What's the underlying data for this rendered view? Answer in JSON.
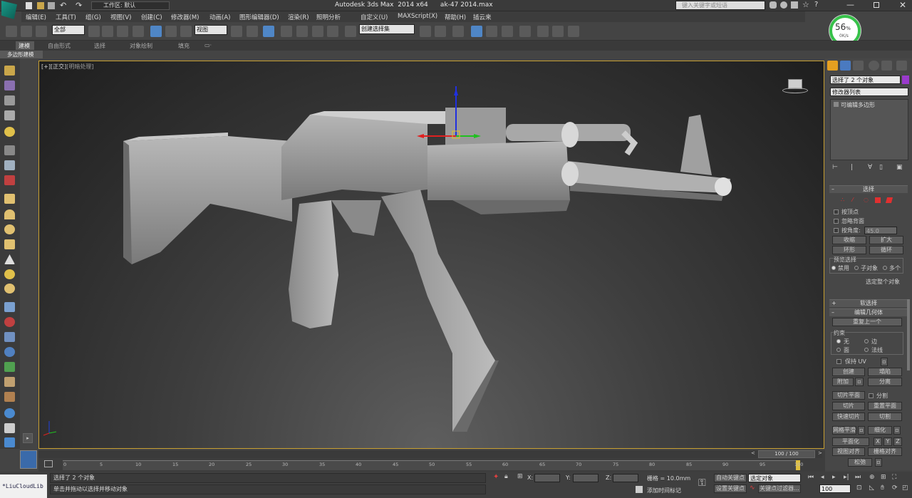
{
  "app": {
    "workspace_label": "工作区: 默认",
    "title": "Autodesk 3ds Max  2014 x64      ak-47 2014.max",
    "search_placeholder": "键入关键字或短语"
  },
  "menus": [
    "编辑(E)",
    "工具(T)",
    "组(G)",
    "视图(V)",
    "创建(C)",
    "修改器(M)",
    "动画(A)",
    "图形编辑器(D)",
    "渲染(R)",
    "照明分析",
    "自定义(U)",
    "MAXScript(X)",
    "帮助(H)",
    "插云来"
  ],
  "toolbar": {
    "selection_filter": "全部",
    "ref_coord": "视图",
    "named_sel": "创建选择集"
  },
  "ribbon": {
    "tabs": [
      "建模",
      "自由形式",
      "选择",
      "对象绘制",
      "填充"
    ],
    "sub_tab": "多边形建模"
  },
  "viewport": {
    "label_plus": "[+]",
    "label_view": "[正交]",
    "label_shade": "[明暗处理]"
  },
  "perf_meter": {
    "percent": "56",
    "percent_sign": "%",
    "rate": "0K/s"
  },
  "command_panel": {
    "selection_info": "选择了 2 个对象",
    "modifier_list": "修改器列表",
    "stack_item": "可编辑多边形",
    "rollout_selection": "选择",
    "by_vertex": "按顶点",
    "ignore_backfacing": "忽略背面",
    "by_angle": "按角度:",
    "angle_value": "45.0",
    "shrink": "收缩",
    "grow": "扩大",
    "ring": "环形",
    "loop": "循环",
    "preview_selection": "预览选择",
    "preview_off": "禁用",
    "preview_subobj": "子对象",
    "preview_multi": "多个",
    "selected_count": "选定整个对象",
    "rollout_soft": "软选择",
    "rollout_edit_geom": "编辑几何体",
    "repeat_last": "重复上一个",
    "constraints": "约束",
    "c_none": "无",
    "c_edge": "边",
    "c_face": "面",
    "c_normal": "法线",
    "preserve_uv": "保持 UV",
    "create": "创建",
    "collapse": "塌陷",
    "attach": "附加",
    "detach": "分离",
    "slice_plane": "切片平面",
    "split": "分割",
    "slice": "切片",
    "reset_plane": "重置平面",
    "quickslice": "快速切片",
    "cut": "切割",
    "meshsmooth": "网格平滑",
    "tessellate": "细化",
    "make_planar": "平面化",
    "x": "X",
    "y": "Y",
    "z": "Z",
    "view_align": "视图对齐",
    "grid_align": "栅格对齐",
    "relax": "松弛"
  },
  "timeline": {
    "frame_display": "100 / 100",
    "ticks": [
      "0",
      "5",
      "10",
      "15",
      "20",
      "25",
      "30",
      "35",
      "40",
      "45",
      "50",
      "55",
      "60",
      "65",
      "70",
      "75",
      "80",
      "85",
      "90",
      "95",
      "100"
    ]
  },
  "status": {
    "brand": "*LiuCloudLib",
    "line1": "选择了 2 个对象",
    "line2": "单击并拖动以选择并移动对象",
    "x_label": "X:",
    "y_label": "Y:",
    "z_label": "Z:",
    "grid": "栅格 = 10.0mm",
    "auto_key": "自动关键点",
    "set_key": "设置关键点",
    "sel_mode": "选定对象",
    "add_time_tag": "添加时间标记",
    "key_filters": "关键点过滤器...",
    "frame_field": "100"
  }
}
